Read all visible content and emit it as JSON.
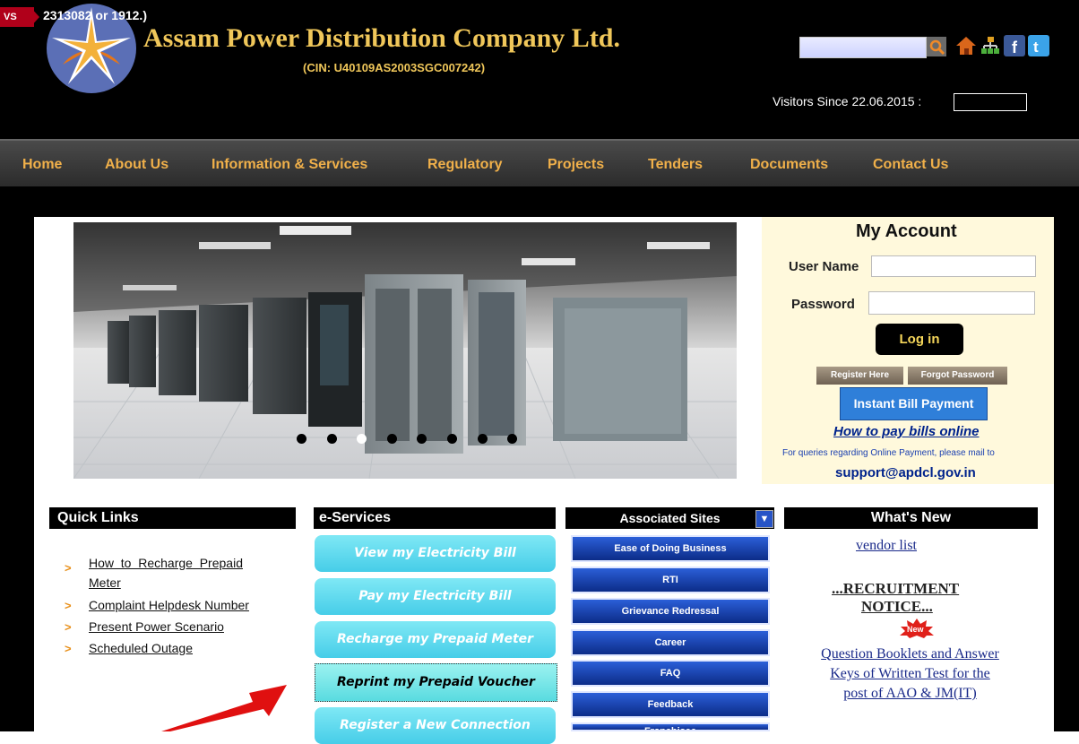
{
  "header": {
    "title": "Assam Power Distribution Company Ltd.",
    "cin": "(CIN: U40109AS2003SGC007242)",
    "visitors_label": "Visitors Since 22.06.2015 :",
    "icons": [
      "search-icon",
      "home-icon",
      "sitemap-icon",
      "facebook-icon",
      "twitter-icon"
    ]
  },
  "nav": {
    "items": [
      "Home",
      "About Us",
      "Information & Services",
      "Regulatory",
      "Projects",
      "Tenders",
      "Documents",
      "Contact Us"
    ]
  },
  "ticker": {
    "tag": "VS",
    "text": "2313082 or 1912.)"
  },
  "slider": {
    "dot_count": 8,
    "active_dot": 3
  },
  "account": {
    "title": "My Account",
    "user_label": "User Name",
    "password_label": "Password",
    "login_label": "Log in",
    "register_label": "Register Here",
    "forgot_label": "Forgot Password",
    "instant_label": "Instant Bill Payment",
    "howto_label": "How to pay bills online",
    "queries_text": "For queries regarding Online Payment, please mail to",
    "support_email": "support@apdcl.gov.in"
  },
  "quick_links": {
    "title": "Quick Links",
    "items": [
      "How  to  Recharge  Prepaid",
      "Meter",
      "Complaint Helpdesk Number",
      "Present Power Scenario",
      "Scheduled Outage"
    ]
  },
  "eservices": {
    "title": "e-Services",
    "items": [
      "View my Electricity Bill",
      "Pay my Electricity Bill",
      "Recharge my Prepaid Meter",
      "Reprint my Prepaid Voucher",
      "Register a New Connection"
    ]
  },
  "associated": {
    "title": "Associated Sites",
    "items": [
      "Ease of Doing Business",
      "RTI",
      "Grievance Redressal",
      "Career",
      "FAQ",
      "Feedback",
      "Franchisee"
    ]
  },
  "whats_new": {
    "title": "What's New",
    "vendor": "vendor list",
    "recruit_1": "...RECRUITMENT",
    "recruit_2": "NOTICE...",
    "badge": "New",
    "q1": "Question Booklets and Answer",
    "q2": "Keys of Written Test for the",
    "q3": "post of AAO & JM(IT)"
  },
  "colors": {
    "title_gold": "#f0c75a",
    "nav_text": "#f0b04a",
    "eservice_cyan": "#46cde8",
    "associated_blue": "#1f4bc2",
    "arrow_red": "#e01010"
  }
}
